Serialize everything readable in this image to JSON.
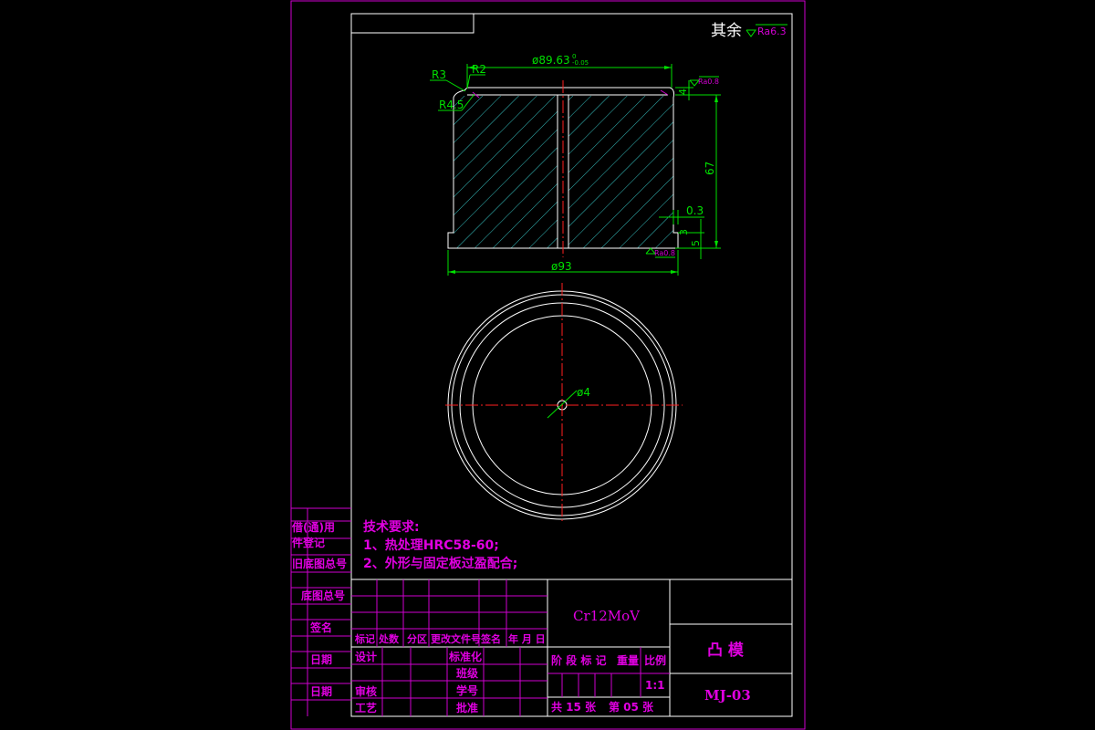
{
  "corner_note": {
    "prefix": "其余",
    "roughness": "Ra6.3"
  },
  "dims": {
    "top_diameter_base": "ø89.63",
    "top_diameter_upper": "0",
    "top_diameter_lower": "-0.05",
    "r3": "R3",
    "r2": "R2",
    "r45": "R4.5",
    "dim_4": "4",
    "ra08": "Ra0.8",
    "dim_67": "67",
    "dim_03": "0.3",
    "dim_3": "3",
    "dim_5": "5",
    "ra08_bottom": "Ra0.8",
    "bottom_diameter": "ø93",
    "hole_diameter": "ø4"
  },
  "tech_req": {
    "title": "技术要求:",
    "item1": "1、热处理HRC58-60;",
    "item2": "2、外形与固定板过盈配合;"
  },
  "side_labels": [
    "借(通)用",
    "件登记",
    "旧底图总号",
    "底图总号",
    "签名",
    "日期",
    "日期"
  ],
  "title_block": {
    "material": "Cr12MoV",
    "part_name": "凸  模",
    "drawing_no": "MJ-03",
    "rev_headers": [
      "标记",
      "处数",
      "分区",
      "更改文件号",
      "签名",
      "年 月 日"
    ],
    "left_rows": [
      "设计",
      "审核",
      "工艺"
    ],
    "mid_rows": [
      "标准化",
      "班级",
      "学号",
      "批准"
    ],
    "stage_headers": [
      "阶 段 标 记",
      "重量",
      "比例"
    ],
    "scale": "1:1",
    "sheets_total": "共 15 张",
    "sheet_no": "第 05 张"
  }
}
